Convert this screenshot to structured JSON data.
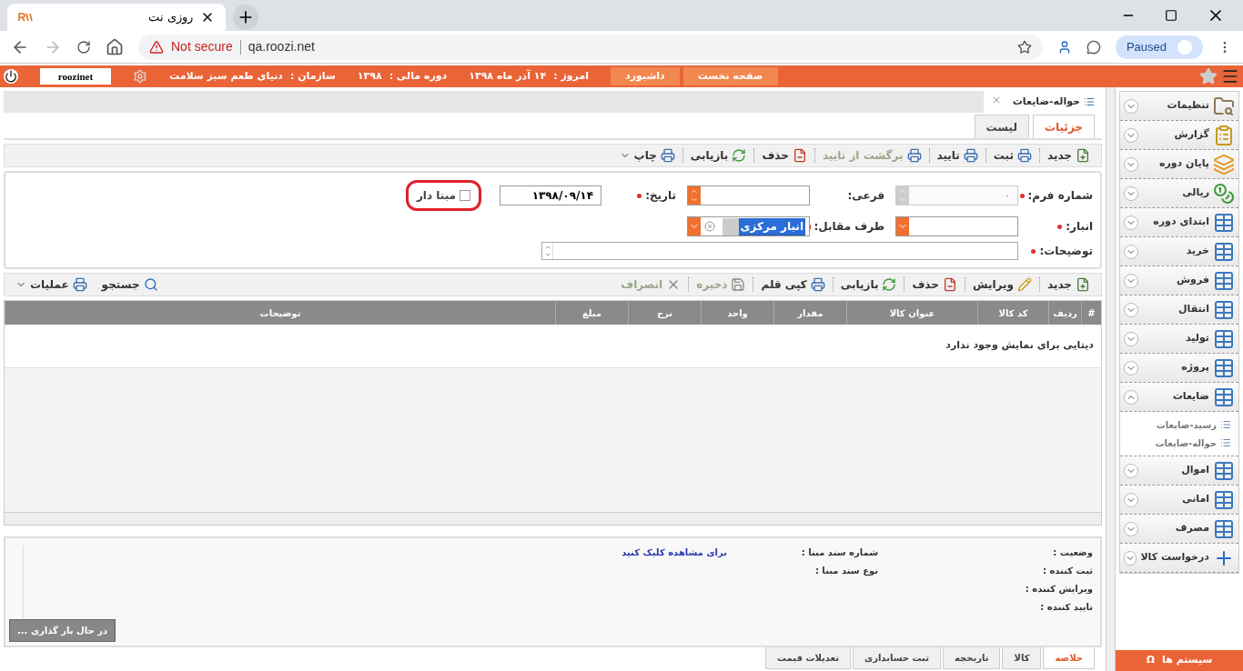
{
  "browser": {
    "tab_title": "روزی نت",
    "security": "Not secure",
    "url": "qa.roozi.net",
    "profile": "Paused"
  },
  "topbar": {
    "user": "roozinet",
    "info": [
      {
        "label": "امروز :",
        "value": "۱۴ آذر ماه ۱۳۹۸"
      },
      {
        "label": "دوره مالی :",
        "value": "۱۳۹۸"
      },
      {
        "label": "سازمان :",
        "value": "دنیای طعم سبز سلامت"
      }
    ],
    "buttons": [
      "صفحه نخست",
      "داشبورد"
    ]
  },
  "page_tab": {
    "title": "حواله-ضایعات"
  },
  "view_tabs": [
    {
      "label": "جزئیات",
      "selected": true
    },
    {
      "label": "لیست",
      "selected": false
    }
  ],
  "main_toolbar": [
    {
      "kind": "new",
      "label": "جدید",
      "disabled": false
    },
    {
      "kind": "record",
      "label": "ثبت",
      "disabled": false
    },
    {
      "kind": "record",
      "label": "تایید",
      "disabled": false
    },
    {
      "kind": "record",
      "label": "برگشت از تایید",
      "disabled": true
    },
    {
      "kind": "delete",
      "label": "حذف",
      "disabled": false
    },
    {
      "kind": "refresh",
      "label": "بازیابی",
      "disabled": false
    },
    {
      "kind": "record",
      "label": "چاپ",
      "disabled": false,
      "menu": true
    }
  ],
  "form": {
    "rows": [
      [
        {
          "kind": "spinner",
          "label": "شماره فرم:",
          "required": true,
          "value": "۰",
          "disabled": true
        },
        {
          "kind": "spinner",
          "label": "فرعی:",
          "disabled": false
        },
        {
          "kind": "text",
          "label": "تاریخ:",
          "required": true,
          "value": "۱۳۹۸/۰۹/۱۴"
        },
        {
          "kind": "checkbox",
          "label": "مبنا دار",
          "checked": false
        }
      ],
      [
        {
          "kind": "dropdown",
          "label": "انبار:",
          "required": true
        },
        {
          "kind": "dropdown",
          "label": "طرف مقابل:",
          "required": true,
          "value": "انبار مرکزی",
          "highlighted": true
        }
      ],
      [
        {
          "kind": "textarea",
          "label": "توضیحات:",
          "required": true
        }
      ]
    ]
  },
  "grid_toolbar": [
    {
      "kind": "new",
      "label": "جدید",
      "disabled": false
    },
    {
      "kind": "edit",
      "label": "ویرایش",
      "disabled": false
    },
    {
      "kind": "delete",
      "label": "حذف",
      "disabled": false
    },
    {
      "kind": "refresh",
      "label": "بازیابی",
      "disabled": false
    },
    {
      "kind": "record",
      "label": "کپی قلم",
      "disabled": false
    },
    {
      "kind": "save",
      "label": "ذخیره",
      "disabled": true
    },
    {
      "kind": "cancel",
      "label": "انصراف",
      "disabled": true
    }
  ],
  "grid_tools": [
    {
      "kind": "search",
      "label": "جستجو",
      "menu": false
    },
    {
      "kind": "record",
      "label": "عملیات",
      "menu": true
    }
  ],
  "table": {
    "columns": [
      "#",
      "ردیف",
      "کد کالا",
      "عنوان کالا",
      "مقدار",
      "واحد",
      "نرخ",
      "مبلغ",
      "توضیحات"
    ],
    "empty_message": "دیتایی برای نمایش وجود ندارد"
  },
  "summary": {
    "fields": [
      "وضعیت :",
      "ثبت کننده :",
      "ویرایش کننده :",
      "تایید کننده :"
    ],
    "source_fields": [
      "شماره سند مبنا :",
      "نوع سند مبنا :"
    ],
    "link": "برای مشاهده کلیک کنید"
  },
  "loading": "در حال بار گذاری ...",
  "bottom_tabs": [
    {
      "label": "خلاصه",
      "selected": true
    },
    {
      "label": "کالا",
      "selected": false
    },
    {
      "label": "تاریخچه",
      "selected": false
    },
    {
      "label": "ثبت حسابداری",
      "selected": false
    },
    {
      "label": "تعدیلات قیمت",
      "selected": false
    }
  ],
  "sidebar": {
    "items": [
      {
        "kind": "settings",
        "label": "تنظیمات",
        "expanded": false
      },
      {
        "kind": "report",
        "label": "گزارش",
        "expanded": false
      },
      {
        "kind": "stack",
        "label": "پایان دوره",
        "expanded": false
      },
      {
        "kind": "money",
        "label": "ریالی",
        "expanded": false
      },
      {
        "kind": "table",
        "label": "ابتدای دوره",
        "expanded": false
      },
      {
        "kind": "table",
        "label": "خرید",
        "expanded": false
      },
      {
        "kind": "table",
        "label": "فروش",
        "expanded": false
      },
      {
        "kind": "table",
        "label": "انتقال",
        "expanded": false
      },
      {
        "kind": "table",
        "label": "تولید",
        "expanded": false
      },
      {
        "kind": "table",
        "label": "پروژه",
        "expanded": false
      },
      {
        "kind": "table",
        "label": "ضایعات",
        "expanded": true,
        "children": [
          {
            "label": "رسید-ضایعات"
          },
          {
            "label": "حواله-ضایعات"
          }
        ]
      },
      {
        "kind": "table",
        "label": "اموال",
        "expanded": false
      },
      {
        "kind": "table",
        "label": "امانی",
        "expanded": false
      },
      {
        "kind": "table",
        "label": "مصرف",
        "expanded": false
      },
      {
        "kind": "plus",
        "label": "درخواست کالا",
        "expanded": false
      }
    ],
    "systems_button": {
      "icon": "Ω",
      "label": "سیستم ها"
    }
  }
}
